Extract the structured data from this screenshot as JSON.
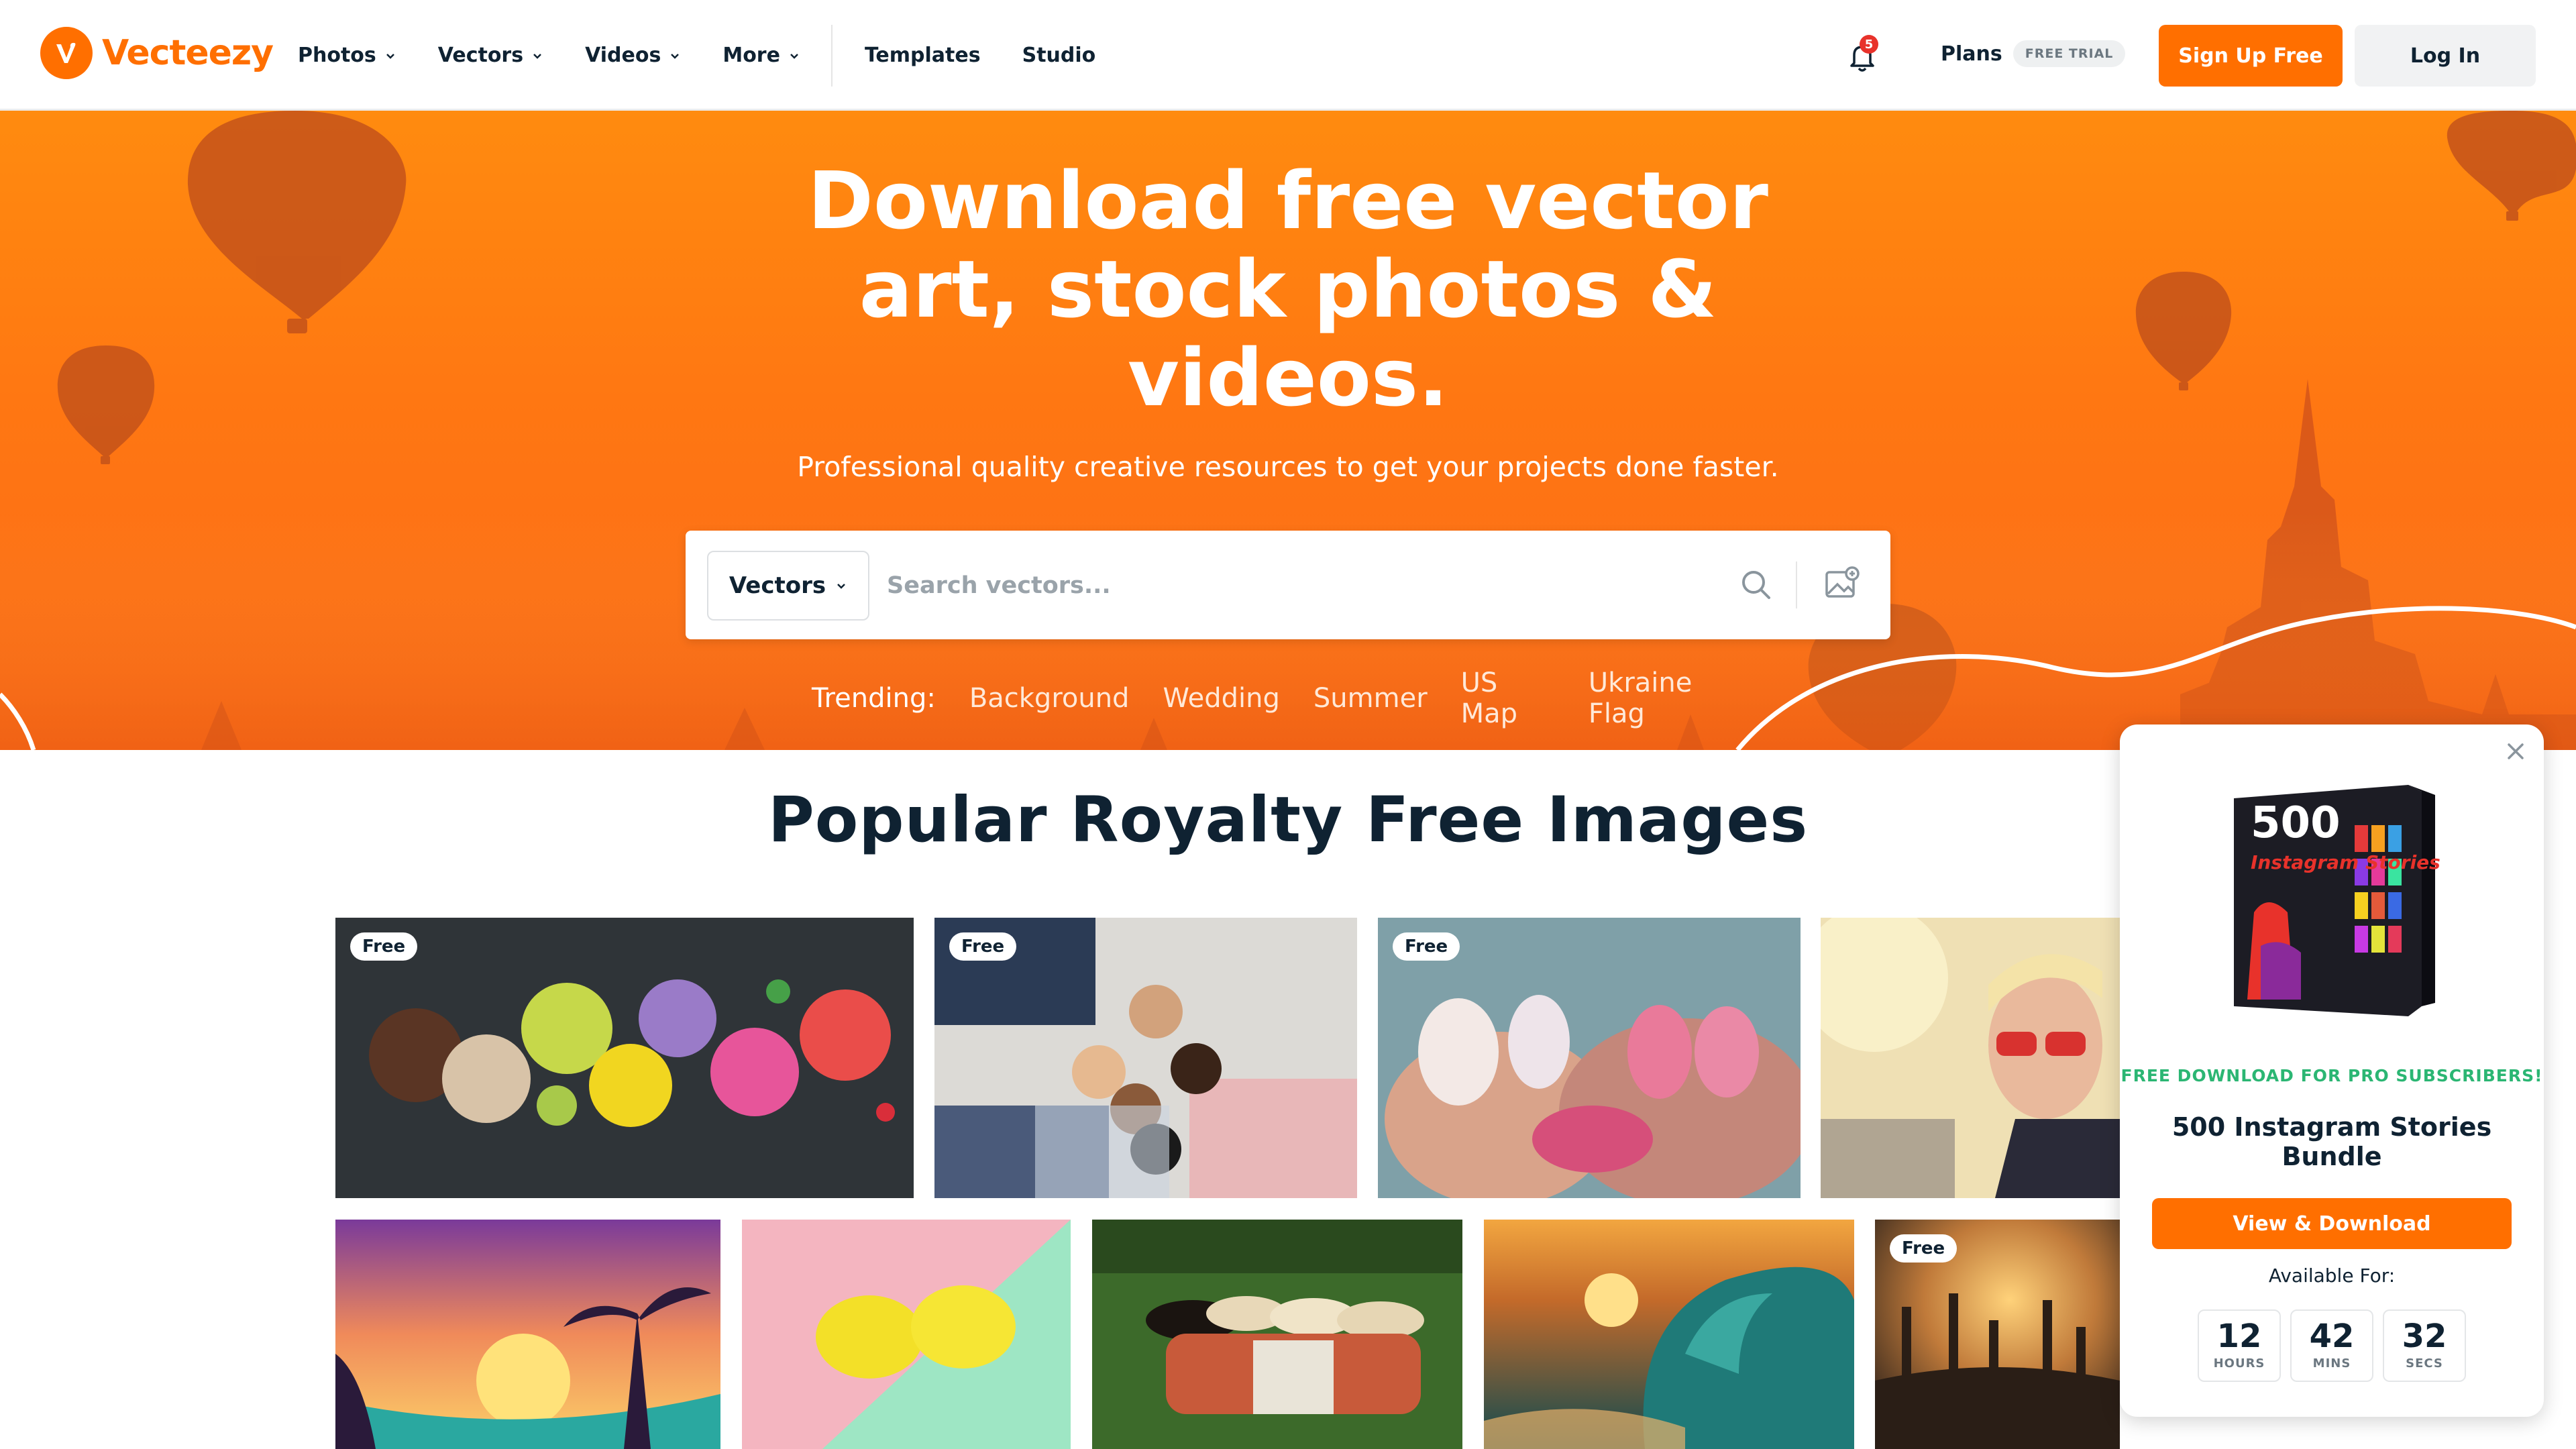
{
  "brand": {
    "name": "Vecteezy",
    "accent": "#ff6f00"
  },
  "nav": {
    "items": [
      {
        "label": "Photos"
      },
      {
        "label": "Vectors"
      },
      {
        "label": "Videos"
      },
      {
        "label": "More"
      },
      {
        "label": "Templates"
      },
      {
        "label": "Studio"
      }
    ]
  },
  "header": {
    "notification_count": "5",
    "plans_label": "Plans",
    "trial_badge": "FREE TRIAL",
    "signup_label": "Sign Up Free",
    "login_label": "Log In"
  },
  "hero": {
    "title": "Download free vector art, stock photos & videos.",
    "subtitle": "Professional quality creative resources to get your projects done faster.",
    "search": {
      "selected_type": "Vectors",
      "placeholder": "Search vectors..."
    },
    "trending_label": "Trending:",
    "trending": [
      "Background",
      "Wedding",
      "Summer",
      "US Map",
      "Ukraine Flag"
    ]
  },
  "section": {
    "title": "Popular Royalty Free Images"
  },
  "tiles": [
    {
      "subject": "ice cream scoops on slate",
      "badge": "Free"
    },
    {
      "subject": "friends lying in a circle",
      "badge": "Free"
    },
    {
      "subject": "manicured nails with flowers",
      "badge": "Free"
    },
    {
      "subject": "woman with red sunglasses",
      "badge": ""
    },
    {
      "subject": "tropical sunset illustration",
      "badge": ""
    },
    {
      "subject": "lemon on pastel background",
      "badge": ""
    },
    {
      "subject": "women hugging in grass",
      "badge": ""
    },
    {
      "subject": "ocean wave at sunset",
      "badge": ""
    },
    {
      "subject": "crowd at concert",
      "badge": "Free"
    }
  ],
  "promo": {
    "box_text": "500",
    "box_subtitle": "Instagram Stories",
    "kicker": "FREE DOWNLOAD FOR PRO SUBSCRIBERS!",
    "title": "500 Instagram Stories Bundle",
    "button_label": "View & Download",
    "available_label": "Available For:",
    "countdown": [
      {
        "value": "12",
        "unit": "HOURS"
      },
      {
        "value": "42",
        "unit": "MINS"
      },
      {
        "value": "32",
        "unit": "SECS"
      }
    ]
  }
}
